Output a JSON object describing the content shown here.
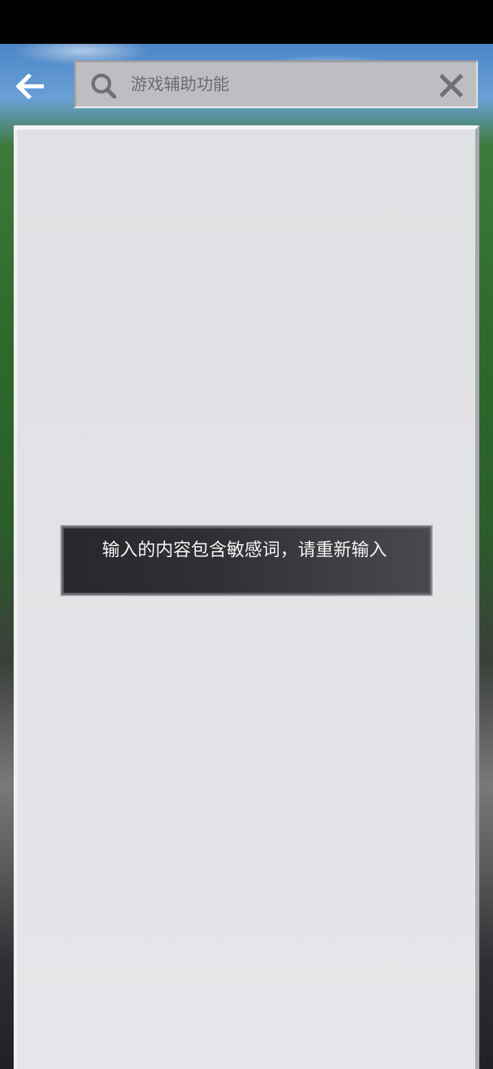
{
  "search": {
    "placeholder": "游戏辅助功能",
    "value": ""
  },
  "icons": {
    "back": "back-arrow-icon",
    "search": "search-icon",
    "clear": "close-icon"
  },
  "toast": {
    "message": "输入的内容包含敏感词，请重新输入"
  },
  "colors": {
    "panel_background": "#e2e3e6",
    "search_background": "#bcbec1",
    "toast_background": "#2f3034",
    "icon_gray": "#6e7074"
  }
}
